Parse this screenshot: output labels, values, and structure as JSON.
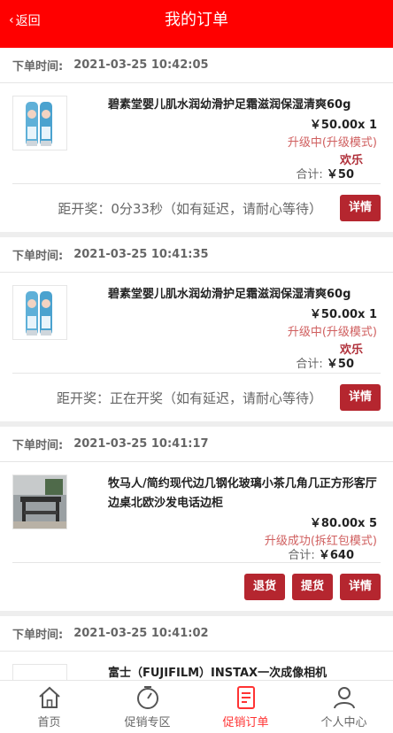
{
  "header": {
    "back_label": "返回",
    "title": "我的订单"
  },
  "orders": [
    {
      "time_label": "下单时间:",
      "time": "2021-03-25 10:42:05",
      "product": "碧素堂婴儿肌水润幼滑护足霜滋润保湿清爽60g",
      "price": "￥50.00x 1",
      "status": "升级中(升级模式)",
      "tag": "欢乐",
      "total_label": "合计:",
      "total": "￥50",
      "countdown": "距开奖：0分33秒（如有延迟，请耐心等待）",
      "buttons": [
        "详情"
      ]
    },
    {
      "time_label": "下单时间:",
      "time": "2021-03-25 10:41:35",
      "product": "碧素堂婴儿肌水润幼滑护足霜滋润保湿清爽60g",
      "price": "￥50.00x 1",
      "status": "升级中(升级模式)",
      "tag": "欢乐",
      "total_label": "合计:",
      "total": "￥50",
      "countdown": "距开奖：正在开奖（如有延迟，请耐心等待）",
      "buttons": [
        "详情"
      ]
    },
    {
      "time_label": "下单时间:",
      "time": "2021-03-25 10:41:17",
      "product": "牧马人/简约现代边几钢化玻璃小茶几角几正方形客厅边桌北欧沙发电话边柜",
      "price": "￥80.00x 5",
      "status": "升级成功(拆红包模式)",
      "tag": "",
      "total_label": "合计:",
      "total": "￥640",
      "countdown": "",
      "buttons": [
        "退货",
        "提货",
        "详情"
      ]
    },
    {
      "time_label": "下单时间:",
      "time": "2021-03-25 10:41:02",
      "product": "富士（FUJIFILM）INSTAX一次成像相机"
    }
  ],
  "tabbar": [
    {
      "label": "首页",
      "icon": "home-icon"
    },
    {
      "label": "促销专区",
      "icon": "timer-icon"
    },
    {
      "label": "促销订单",
      "icon": "order-doc-icon",
      "active": true
    },
    {
      "label": "个人中心",
      "icon": "user-icon"
    }
  ],
  "colors": {
    "header": "#ff0000",
    "button": "#b5262f",
    "status": "#d06060",
    "active_tab": "#ff3333"
  }
}
